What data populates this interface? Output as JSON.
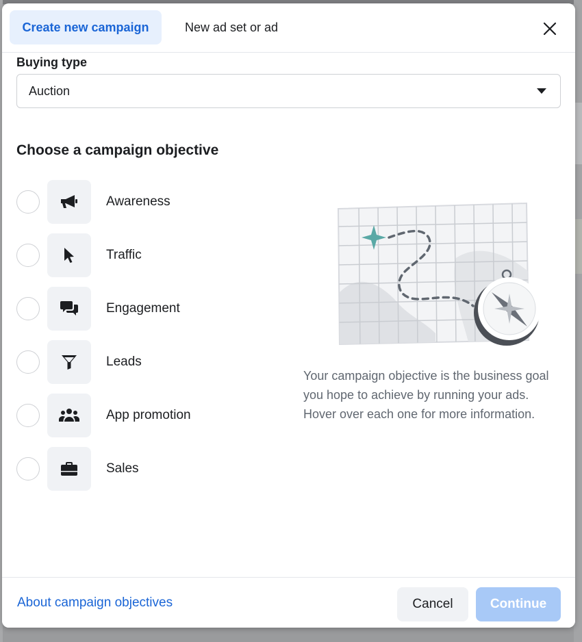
{
  "header": {
    "tabs": [
      {
        "label": "Create new campaign",
        "active": true
      },
      {
        "label": "New ad set or ad",
        "active": false
      }
    ],
    "close_icon": "close-icon"
  },
  "buying_type": {
    "label": "Buying type",
    "selected": "Auction"
  },
  "objectives": {
    "title": "Choose a campaign objective",
    "items": [
      {
        "label": "Awareness",
        "icon": "megaphone-icon"
      },
      {
        "label": "Traffic",
        "icon": "cursor-icon"
      },
      {
        "label": "Engagement",
        "icon": "chat-bubbles-icon"
      },
      {
        "label": "Leads",
        "icon": "funnel-icon"
      },
      {
        "label": "App promotion",
        "icon": "people-icon"
      },
      {
        "label": "Sales",
        "icon": "briefcase-icon"
      }
    ]
  },
  "info": {
    "description": "Your campaign objective is the business goal you hope to achieve by running your ads. Hover over each one for more information."
  },
  "footer": {
    "about_link": "About campaign objectives",
    "cancel_label": "Cancel",
    "continue_label": "Continue"
  },
  "colors": {
    "accent": "#1a65d6",
    "tab_active_bg": "#e7f0fd",
    "continue_disabled_bg": "#a8c9f7",
    "icon_tile_bg": "#f0f2f5",
    "sparkle": "#5aa9a6"
  }
}
